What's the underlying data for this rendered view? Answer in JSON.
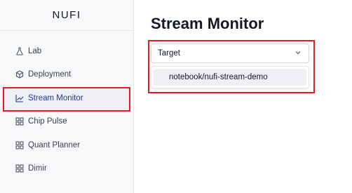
{
  "app": {
    "brand": "NUFI"
  },
  "sidebar": {
    "items": [
      {
        "label": "Lab",
        "icon": "flask-icon"
      },
      {
        "label": "Deployment",
        "icon": "cube-icon"
      },
      {
        "label": "Stream Monitor",
        "icon": "chart-line-icon",
        "active": true
      },
      {
        "label": "Chip Pulse",
        "icon": "grid-icon"
      },
      {
        "label": "Quant Planner",
        "icon": "grid-icon"
      },
      {
        "label": "Dimir",
        "icon": "grid-icon"
      }
    ]
  },
  "main": {
    "title": "Stream Monitor",
    "target_select": {
      "label": "Target",
      "options": [
        "notebook/nufi-stream-demo"
      ]
    }
  },
  "colors": {
    "highlight_border": "#e11d25",
    "active_text": "#1e3a8a",
    "sidebar_bg": "#f8f9fb"
  }
}
